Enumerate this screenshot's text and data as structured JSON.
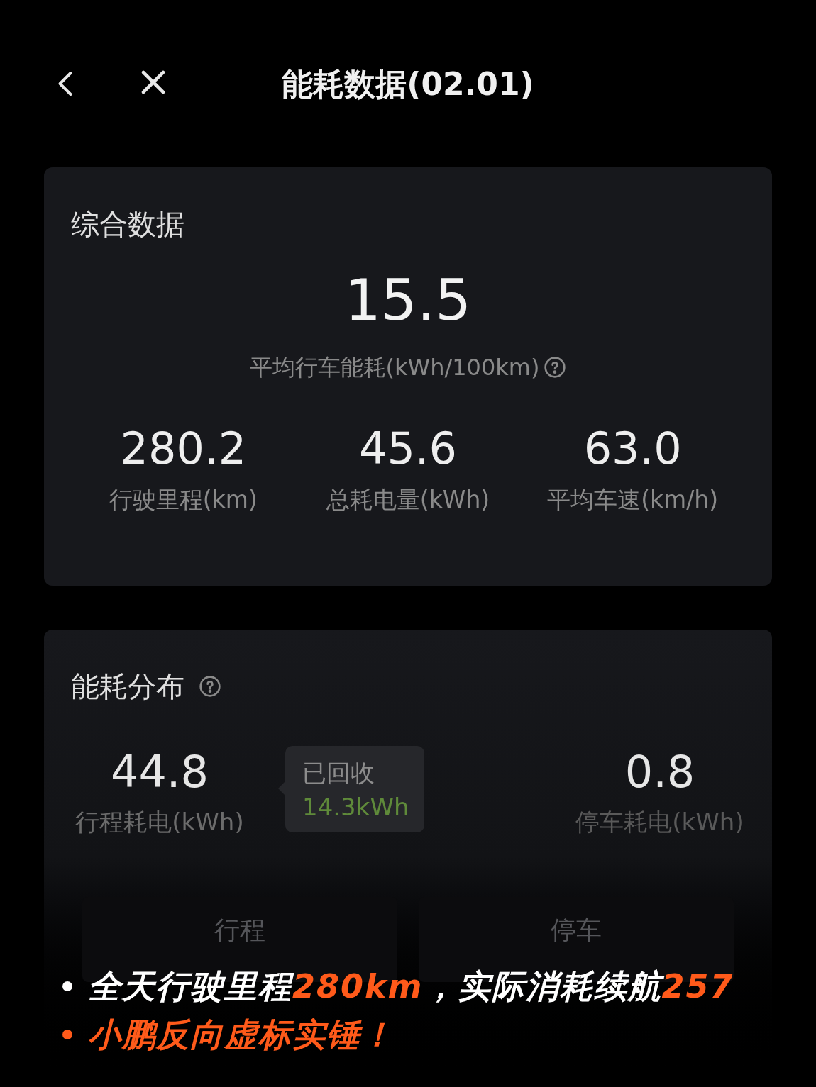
{
  "header": {
    "title": "能耗数据(02.01)"
  },
  "summary": {
    "title": "综合数据",
    "value": "15.5",
    "label": "平均行车能耗(kWh/100km)",
    "stats": [
      {
        "value": "280.2",
        "label": "行驶里程(km)"
      },
      {
        "value": "45.6",
        "label": "总耗电量(kWh)"
      },
      {
        "value": "63.0",
        "label": "平均车速(km/h)"
      }
    ]
  },
  "distribution": {
    "title": "能耗分布",
    "trip": {
      "value": "44.8",
      "label": "行程耗电(kWh)"
    },
    "recovered": {
      "label": "已回收",
      "value": "14.3kWh"
    },
    "parking": {
      "value": "0.8",
      "label": "停车耗电(kWh)"
    },
    "tabs": [
      {
        "label": "行程"
      },
      {
        "label": "停车"
      }
    ]
  },
  "caption": [
    {
      "color": "#ffffff",
      "segments": [
        {
          "text": "全天行驶里程",
          "highlight": false
        },
        {
          "text": "280km",
          "highlight": true
        },
        {
          "text": "，实际消耗续航",
          "highlight": false
        },
        {
          "text": "257",
          "highlight": true
        }
      ]
    },
    {
      "color": "#ff5a1a",
      "segments": [
        {
          "text": "小鹏反向虚标实锤！",
          "highlight": true
        }
      ]
    }
  ]
}
